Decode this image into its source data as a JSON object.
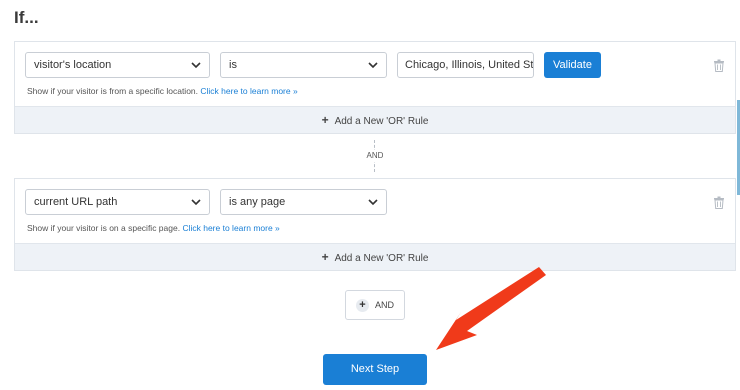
{
  "heading": "If...",
  "rule1": {
    "attribute": "visitor's location",
    "operator": "is",
    "value": "Chicago, Illinois, United State",
    "validate_label": "Validate",
    "hint_text": "Show if your visitor is from a specific location.",
    "hint_link": "Click here to learn more »",
    "or_label": "Add a New 'OR' Rule"
  },
  "connector_label": "AND",
  "rule2": {
    "attribute": "current URL path",
    "operator": "is any page",
    "hint_text": "Show if your visitor is on a specific page.",
    "hint_link": "Click here to learn more »",
    "or_label": "Add a New 'OR' Rule"
  },
  "add_and_label": "AND",
  "next_step_label": "Next Step",
  "colors": {
    "primary": "#1a7fd5",
    "arrow": "#f03a1a",
    "or_bar": "#eef2f7"
  }
}
